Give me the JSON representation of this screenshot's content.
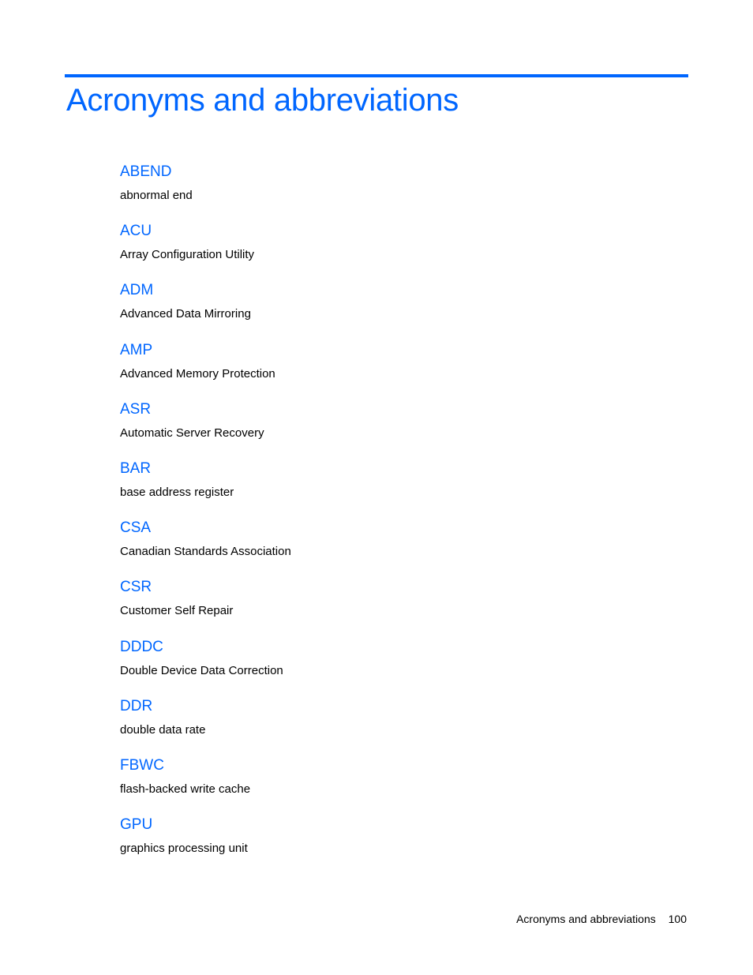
{
  "page": {
    "title": "Acronyms and abbreviations",
    "accent_color": "#0066ff",
    "entries": [
      {
        "term": "ABEND",
        "definition": "abnormal end"
      },
      {
        "term": "ACU",
        "definition": "Array Configuration Utility"
      },
      {
        "term": "ADM",
        "definition": "Advanced Data Mirroring"
      },
      {
        "term": "AMP",
        "definition": "Advanced Memory Protection"
      },
      {
        "term": "ASR",
        "definition": "Automatic Server Recovery"
      },
      {
        "term": "BAR",
        "definition": "base address register"
      },
      {
        "term": "CSA",
        "definition": "Canadian Standards Association"
      },
      {
        "term": "CSR",
        "definition": "Customer Self Repair"
      },
      {
        "term": "DDDC",
        "definition": "Double Device Data Correction"
      },
      {
        "term": "DDR",
        "definition": "double data rate"
      },
      {
        "term": "FBWC",
        "definition": "flash-backed write cache"
      },
      {
        "term": "GPU",
        "definition": "graphics processing unit"
      }
    ],
    "footer": {
      "section": "Acronyms and abbreviations",
      "page_number": "100"
    }
  }
}
